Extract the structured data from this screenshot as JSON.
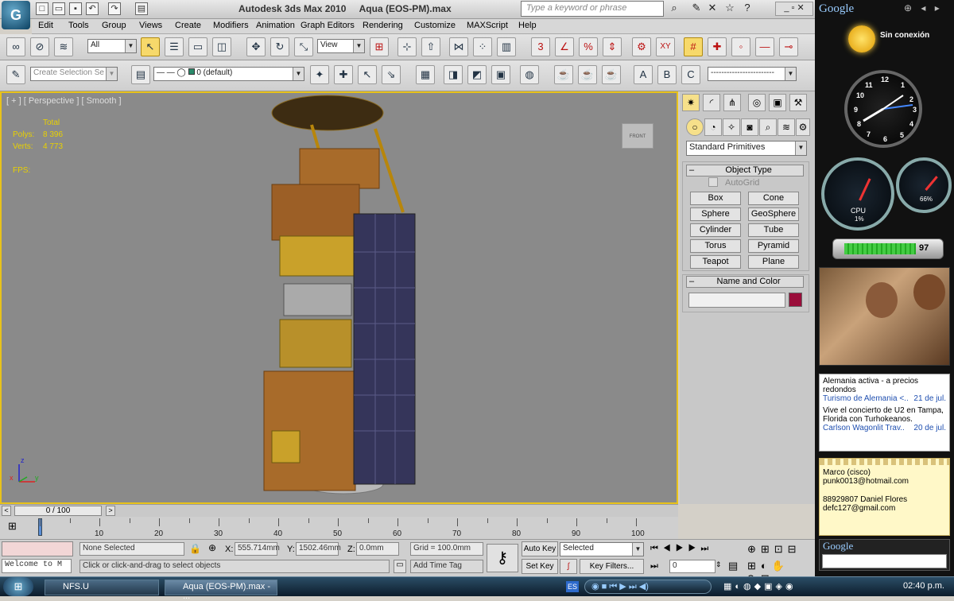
{
  "window": {
    "app_title": "Autodesk 3ds Max  2010",
    "file_title": "Aqua (EOS-PM).max",
    "search_placeholder": "Type a keyword or phrase"
  },
  "menu": [
    "Edit",
    "Tools",
    "Group",
    "Views",
    "Create",
    "Modifiers",
    "Animation",
    "Graph Editors",
    "Rendering",
    "Customize",
    "MAXScript",
    "Help"
  ],
  "toolbar": {
    "filter_value": "All",
    "refcoord_value": "View",
    "snap_labels": [
      "3",
      "%",
      "XY"
    ],
    "selset_placeholder": "Create Selection Se",
    "layer_value": "0 (default)"
  },
  "viewport": {
    "label": "[ + ] [ Perspective ] [ Smooth ]",
    "stats_header": "Total",
    "polys_label": "Polys:",
    "polys_value": "8 396",
    "verts_label": "Verts:",
    "verts_value": "4 773",
    "fps_label": "FPS:",
    "axis_x": "x",
    "axis_y": "y",
    "axis_z": "z"
  },
  "command_panel": {
    "category": "Standard Primitives",
    "object_type_header": "Object Type",
    "autogrid_label": "AutoGrid",
    "buttons": [
      "Box",
      "Cone",
      "Sphere",
      "GeoSphere",
      "Cylinder",
      "Tube",
      "Torus",
      "Pyramid",
      "Teapot",
      "Plane"
    ],
    "name_color_header": "Name and Color",
    "object_name": "",
    "object_color": "#9a0d3a"
  },
  "timeline": {
    "slider_label": "0 / 100",
    "ticks": [
      "10",
      "20",
      "30",
      "40",
      "50",
      "60",
      "70",
      "80",
      "90",
      "100"
    ]
  },
  "status": {
    "maxscript_listener": "Welcome to M",
    "selection": "None Selected",
    "prompt": "Click or click-and-drag to select objects",
    "x_label": "X:",
    "x_value": "555.714mm",
    "y_label": "Y:",
    "y_value": "1502.46mm",
    "z_label": "Z:",
    "z_value": "0.0mm",
    "grid": "Grid = 100.0mm",
    "add_time_tag": "Add Time Tag",
    "auto_key": "Auto Key",
    "set_key": "Set Key",
    "key_mode": "Selected",
    "key_filters": "Key Filters...",
    "frame_value": "0"
  },
  "taskbar": {
    "tasks": [
      "NFS.U",
      "Aqua (EOS-PM).max - ..."
    ],
    "lang": "ES",
    "time": "02:40 p.m."
  },
  "sidebar": {
    "brand": "Google",
    "weather_status": "Sin conexión",
    "clock_numbers": [
      "12",
      "1",
      "2",
      "3",
      "4",
      "5",
      "6",
      "7",
      "8",
      "9",
      "10",
      "11"
    ],
    "cpu_label": "CPU",
    "cpu_value": "1%",
    "mem_value": "66%",
    "battery_value": "97",
    "news": [
      {
        "title": "Alemania activa - a precios redondos",
        "source": "Turismo de Alemania <..",
        "date": "21 de jul."
      },
      {
        "title": "Vive el concierto de U2 en Tampa, Florida con Turhokeanos.",
        "source": "Carlson Wagonlit Trav..",
        "date": "20 de jul."
      }
    ],
    "notes": [
      "Marco (cisco)",
      "punk0013@hotmail.com",
      "",
      "88929807 Daniel Flores",
      "defc127@gmail.com"
    ],
    "search_brand": "Google"
  }
}
